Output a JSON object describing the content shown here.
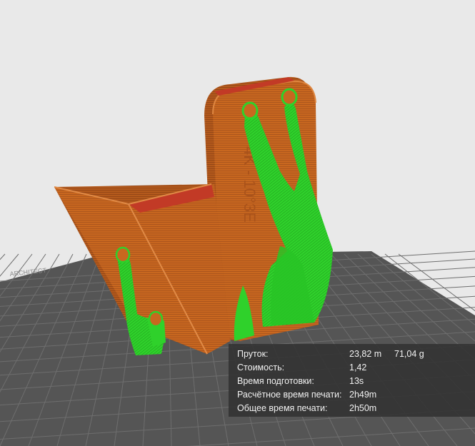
{
  "stats": {
    "filament_label": "Пруток:",
    "filament_length": "23,82 m",
    "filament_weight": "71,04 g",
    "cost_label": "Стоимость:",
    "cost_value": "1,42",
    "prep_time_label": "Время подготовки:",
    "prep_time_value": "13s",
    "est_print_label": "Расчётное время печати:",
    "est_print_value": "2h49m",
    "total_time_label": "Общее время печати:",
    "total_time_value": "2h50m"
  },
  "model": {
    "engraved_text": "4K - 10°3E",
    "plate_label": "ARCHITECT",
    "colors": {
      "part": "#c8671f",
      "part_dark": "#a9521a",
      "part_edge": "#d97c2f",
      "inner": "#cc3a2a",
      "support": "#2ed12a",
      "plate": "#555555",
      "grid": "#6c6c6c",
      "background": "#e9e9e9"
    }
  }
}
